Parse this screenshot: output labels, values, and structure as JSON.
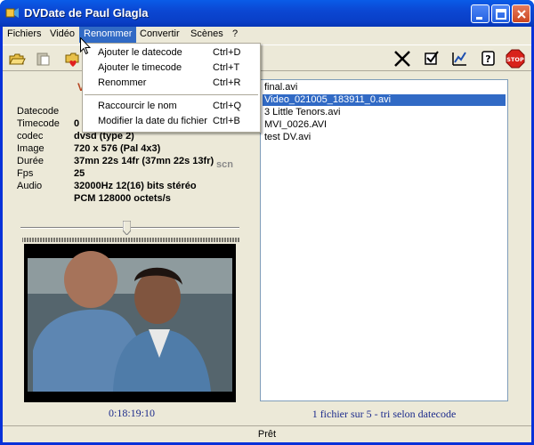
{
  "window": {
    "title": "DVDate de Paul Glagla"
  },
  "menu": {
    "items": [
      "Fichiers",
      "Vidéo",
      "Renommer",
      "Convertir",
      "Scènes",
      "?"
    ],
    "active": "Renommer"
  },
  "dropdown": {
    "items": [
      {
        "label": "Ajouter le datecode",
        "shortcut": "Ctrl+D"
      },
      {
        "label": "Ajouter le timecode",
        "shortcut": "Ctrl+T"
      },
      {
        "label": "Renommer",
        "shortcut": "Ctrl+R"
      },
      {
        "label": "Raccourcir le nom",
        "shortcut": "Ctrl+Q"
      },
      {
        "label": "Modifier la date du fichier",
        "shortcut": "Ctrl+B"
      }
    ]
  },
  "info": {
    "title_fragment": "V",
    "rows": [
      {
        "label": "Datecode",
        "value": ""
      },
      {
        "label": "Timecode",
        "value": "0"
      },
      {
        "label": "codec",
        "value": "dvsd (type 2)"
      },
      {
        "label": "Image",
        "value": "720 x 576 (Pal 4x3)"
      },
      {
        "label": "Durée",
        "value": "37mn 22s 14fr (37mn 22s 13fr)"
      },
      {
        "label": "Fps",
        "value": "25"
      },
      {
        "label": "Audio",
        "value": "32000Hz 12(16) bits  stéréo"
      },
      {
        "label": "",
        "value": "PCM 128000 octets/s"
      }
    ],
    "scn": "scn"
  },
  "player": {
    "timecode": "0:18:19:10",
    "position": 0.5
  },
  "files": {
    "items": [
      "final.avi",
      "Video_021005_183911_0.avi",
      "3 Little Tenors.avi",
      "MVI_0026.AVI",
      "test DV.avi"
    ],
    "selected_index": 1,
    "status": "1 fichier sur 5 - tri selon datecode"
  },
  "statusbar": {
    "text": "Prêt"
  },
  "colors": {
    "title_bar": "#0a5ce8",
    "selection": "#316ac5",
    "panel": "#ece9d8",
    "info_title": "#b5431e",
    "status_text": "#1c2b8c"
  },
  "toolbar_icons": [
    "open-folder-icon",
    "paste-icon",
    "folder-heart-icon",
    "cross-tool-icon",
    "checkbox-icon",
    "chart-icon",
    "help-icon",
    "stop-icon"
  ]
}
